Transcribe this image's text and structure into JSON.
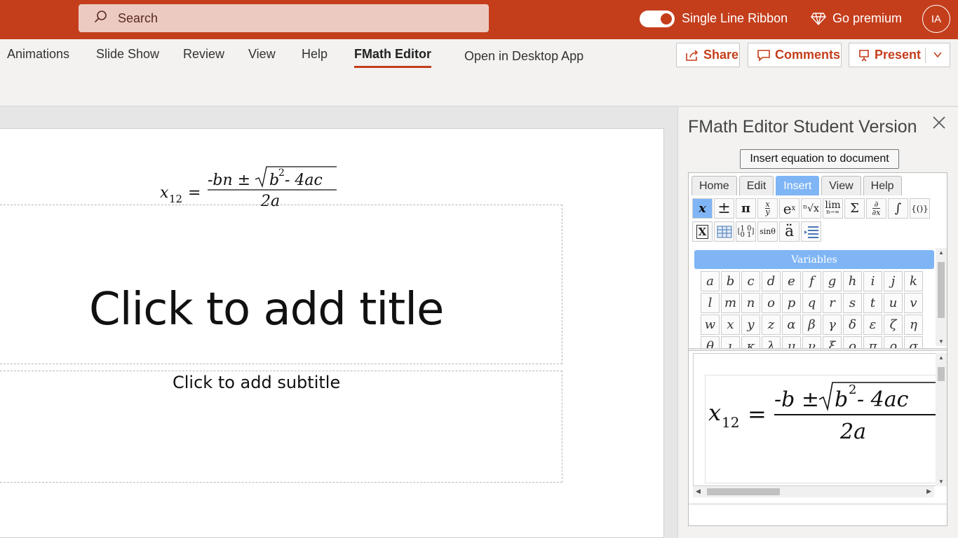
{
  "titlebar": {
    "search_placeholder": "Search",
    "single_line_ribbon_label": "Single Line Ribbon",
    "go_premium_label": "Go premium",
    "avatar_initials": "IA",
    "accent_color": "#c43e1c"
  },
  "ribbon": {
    "tabs": [
      {
        "label": "Animations"
      },
      {
        "label": "Slide Show"
      },
      {
        "label": "Review"
      },
      {
        "label": "View"
      },
      {
        "label": "Help"
      },
      {
        "label": "FMath Editor",
        "active": true
      }
    ],
    "open_desktop_label": "Open in Desktop App",
    "share_label": "Share",
    "comments_label": "Comments",
    "present_label": "Present"
  },
  "slide": {
    "title_placeholder": "Click to add title",
    "subtitle_placeholder": "Click to add subtitle"
  },
  "pane": {
    "title": "FMath Editor Student Version",
    "insert_button": "Insert equation to document",
    "tabs": [
      {
        "label": "Home"
      },
      {
        "label": "Edit"
      },
      {
        "label": "Insert",
        "active": true
      },
      {
        "label": "View"
      },
      {
        "label": "Help"
      }
    ],
    "section_label": "Variables",
    "variables": [
      [
        "a",
        "b",
        "c",
        "d",
        "e",
        "f",
        "g",
        "h",
        "i",
        "j",
        "k"
      ],
      [
        "l",
        "m",
        "n",
        "o",
        "p",
        "q",
        "r",
        "s",
        "t",
        "u",
        "v"
      ],
      [
        "w",
        "x",
        "y",
        "z",
        "α",
        "β",
        "γ",
        "δ",
        "ε",
        "ζ",
        "η"
      ],
      [
        "θ",
        "ι",
        "κ",
        "λ",
        "μ",
        "ν",
        "ξ",
        "ο",
        "π",
        "ρ",
        "σ"
      ]
    ]
  },
  "equation": {
    "lhs_base": "x",
    "lhs_sub": "12",
    "equals": "=",
    "numerator_slide": "-bn ±",
    "numerator_preview": "-b ±",
    "radicand": "b",
    "exponent": "2",
    "radicand_rest": " - 4ac",
    "denominator": "2a"
  }
}
